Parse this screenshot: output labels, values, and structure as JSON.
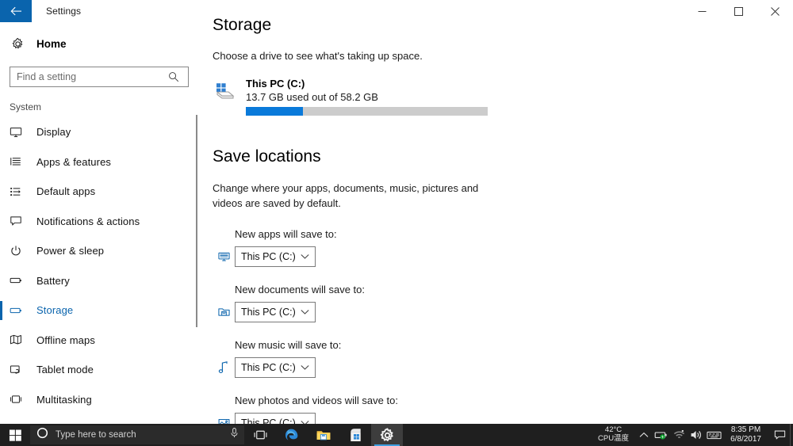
{
  "window": {
    "title": "Settings",
    "back_icon": "back-arrow-icon",
    "minimize_label": "─",
    "maximize_label": "❐",
    "close_label": "✕"
  },
  "sidebar": {
    "home_label": "Home",
    "home_icon": "gear-icon",
    "search": {
      "placeholder": "Find a setting",
      "value": "",
      "icon": "search-icon"
    },
    "group_label": "System",
    "items": [
      {
        "label": "Display",
        "icon": "monitor-icon",
        "active": false
      },
      {
        "label": "Apps & features",
        "icon": "list-icon",
        "active": false
      },
      {
        "label": "Default apps",
        "icon": "default-apps-icon",
        "active": false
      },
      {
        "label": "Notifications & actions",
        "icon": "speech-bubble-icon",
        "active": false
      },
      {
        "label": "Power & sleep",
        "icon": "power-icon",
        "active": false
      },
      {
        "label": "Battery",
        "icon": "battery-icon",
        "active": false
      },
      {
        "label": "Storage",
        "icon": "storage-icon",
        "active": true
      },
      {
        "label": "Offline maps",
        "icon": "map-icon",
        "active": false
      },
      {
        "label": "Tablet mode",
        "icon": "tablet-icon",
        "active": false
      },
      {
        "label": "Multitasking",
        "icon": "multitasking-icon",
        "active": false
      }
    ]
  },
  "main": {
    "page_title": "Storage",
    "subtitle": "Choose a drive to see what's taking up space.",
    "drive": {
      "icon": "hard-drive-icon",
      "name": "This PC (C:)",
      "usage_text": "13.7 GB used out of 58.2 GB",
      "used_gb": 13.7,
      "total_gb": 58.2,
      "percent_used": 23.5,
      "fill_color": "#0a7ada",
      "track_color": "#cccccc"
    },
    "save_locations": {
      "heading": "Save locations",
      "description": "Change where your apps, documents, music, pictures and videos are saved by default.",
      "rows": [
        {
          "label": "New apps will save to:",
          "icon": "monitor-blue-icon",
          "value": "This PC (C:)"
        },
        {
          "label": "New documents will save to:",
          "icon": "documents-folder-icon",
          "value": "This PC (C:)"
        },
        {
          "label": "New music will save to:",
          "icon": "music-note-icon",
          "value": "This PC (C:)"
        },
        {
          "label": "New photos and videos will save to:",
          "icon": "picture-icon",
          "value": "This PC (C:)"
        }
      ],
      "dropdown_arrow_icon": "chevron-down-icon"
    }
  },
  "taskbar": {
    "start_icon": "windows-start-icon",
    "search": {
      "placeholder": "Type here to search",
      "cortana_icon": "cortana-circle-icon",
      "mic_icon": "microphone-icon"
    },
    "buttons": [
      {
        "name": "task-view",
        "icon": "task-view-icon",
        "active": false
      },
      {
        "name": "edge",
        "icon": "edge-browser-icon",
        "active": false
      },
      {
        "name": "file-explorer",
        "icon": "file-explorer-icon",
        "active": false
      },
      {
        "name": "microsoft-store",
        "icon": "microsoft-store-icon",
        "active": false
      },
      {
        "name": "settings",
        "icon": "gear-icon",
        "active": true
      }
    ],
    "tray": {
      "cpu_temp": "42°C",
      "cpu_temp_label": "CPU温度",
      "overflow_icon": "chevron-up-icon",
      "icons": [
        {
          "name": "battery-charging-icon"
        },
        {
          "name": "wifi-icon"
        },
        {
          "name": "volume-icon"
        },
        {
          "name": "keyboard-input-icon"
        }
      ],
      "time": "8:35 PM",
      "date": "6/8/2017",
      "action_center_icon": "action-center-icon"
    }
  },
  "colors": {
    "accent": "#0a64ad",
    "progress": "#0a7ada",
    "taskbar": "#1f1f1f"
  }
}
